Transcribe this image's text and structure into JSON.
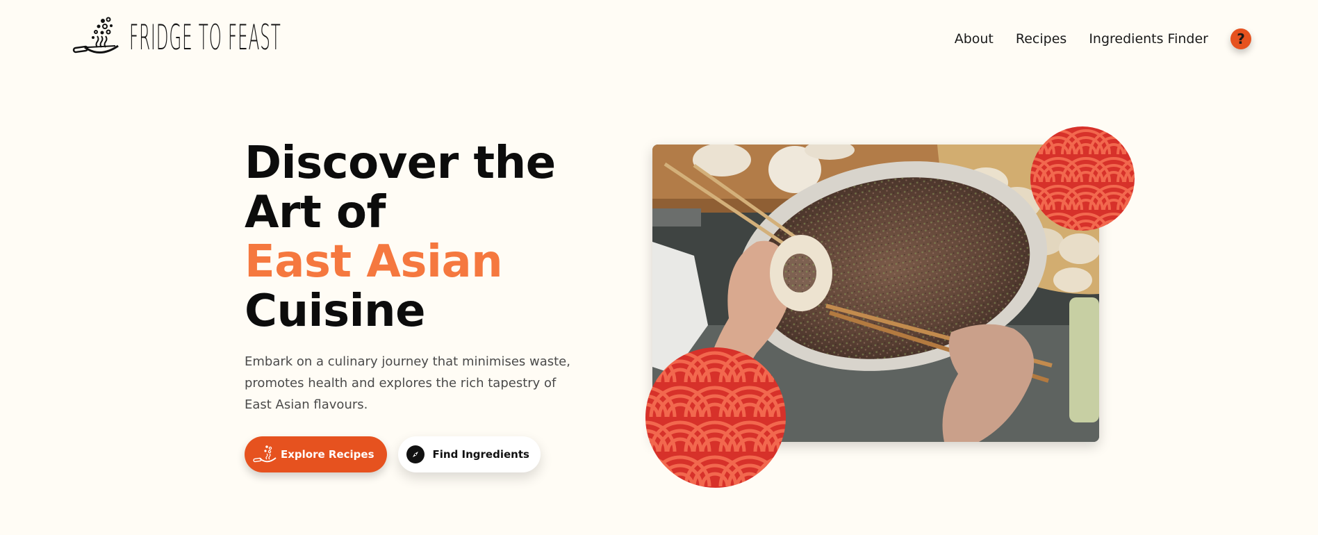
{
  "brand": {
    "name": "FRIDGE TO FEAST"
  },
  "nav": {
    "items": [
      {
        "label": "About"
      },
      {
        "label": "Recipes"
      },
      {
        "label": "Ingredients Finder"
      }
    ],
    "help_label": "?"
  },
  "hero": {
    "title_lines": [
      "Discover the",
      "Art of",
      "East Asian",
      "Cuisine"
    ],
    "description": "Embark on a culinary journey that minimises waste, promotes health and explores the rich tapestry of East Asian flavours.",
    "primary_button": {
      "label": "Explore Recipes",
      "icon": "wok-icon"
    },
    "secondary_button": {
      "label": "Find Ingredients",
      "icon": "compass-icon"
    }
  },
  "colors": {
    "background": "#FFFCF5",
    "accent": "#E6521F",
    "accent_light": "#F5783F",
    "pattern_red": "#D7312A",
    "pattern_light": "#F2684E"
  }
}
